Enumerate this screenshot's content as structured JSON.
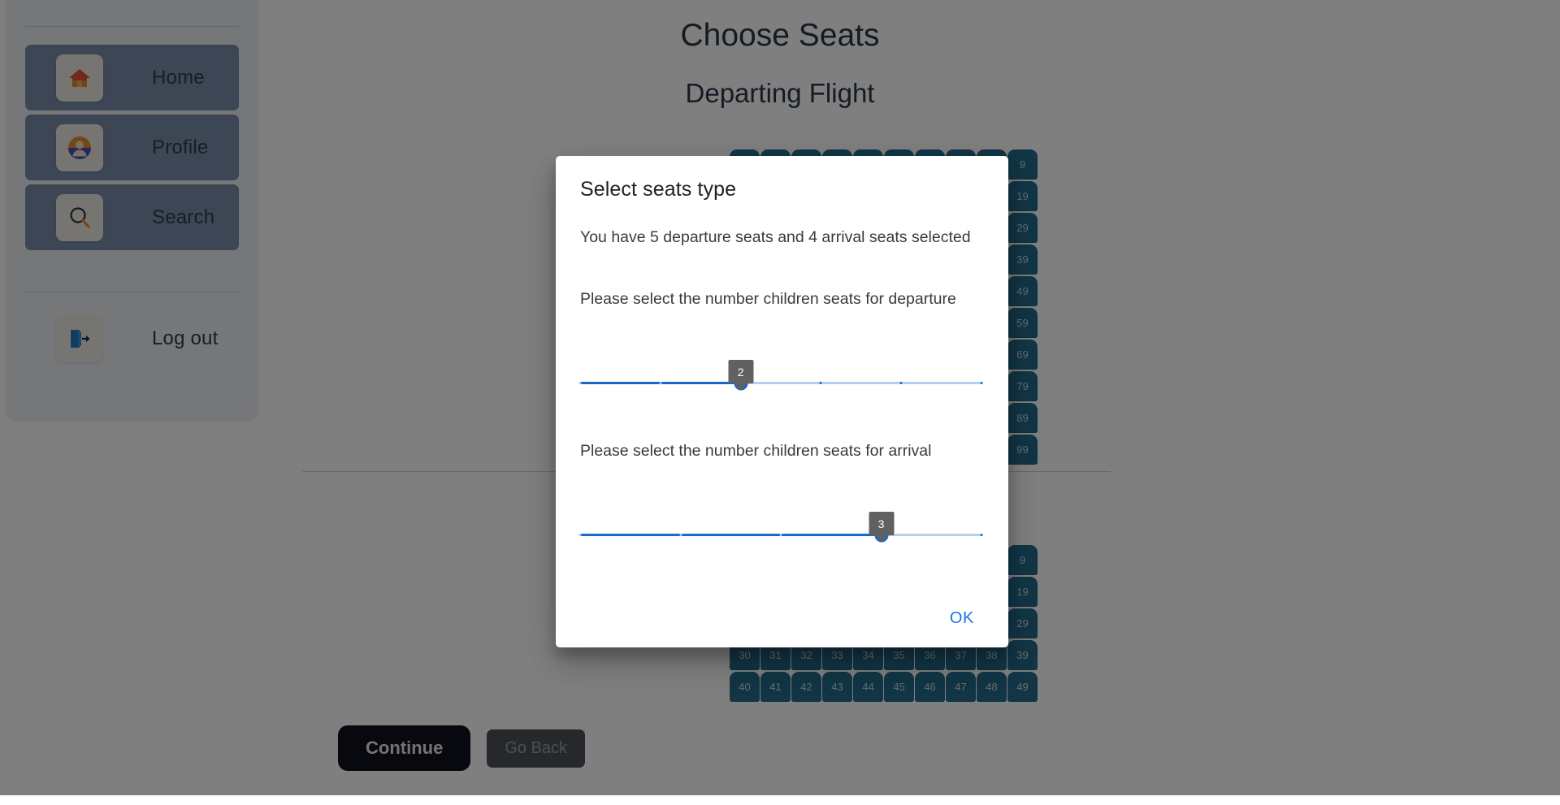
{
  "sidebar": {
    "items": [
      {
        "label": "Home",
        "icon": "home-icon"
      },
      {
        "label": "Profile",
        "icon": "profile-icon"
      },
      {
        "label": "Search",
        "icon": "search-icon"
      }
    ],
    "logout": {
      "label": "Log out",
      "icon": "logout-icon"
    }
  },
  "main": {
    "title": "Choose Seats",
    "subtitle": "Departing Flight",
    "continue_label": "Continue",
    "go_back_label": "Go Back"
  },
  "seats": {
    "departing_right_column": [
      "9",
      "19",
      "29",
      "39",
      "49",
      "59",
      "69",
      "79",
      "89",
      "99"
    ],
    "arriving_right_column": [
      "9",
      "19",
      "29",
      "39"
    ],
    "arriving_rows": [
      [
        "30",
        "31",
        "32",
        "33",
        "34",
        "35",
        "36",
        "37",
        "38",
        "39"
      ],
      [
        "40",
        "41",
        "42",
        "43",
        "44",
        "45",
        "46",
        "47",
        "48",
        "49"
      ]
    ],
    "seat_color": "#256c8c",
    "seat_text_color": "#cfd9de"
  },
  "dialog": {
    "title": "Select seats type",
    "summary": "You have 5 departure seats and 4 arrival seats selected",
    "departure_prompt": "Please select the number children seats for departure",
    "arrival_prompt": "Please select the number children seats for arrival",
    "ok_label": "OK",
    "accent_color": "#1769cc",
    "sliders": [
      {
        "name": "departure-children-seats",
        "value": "2",
        "min": 0,
        "max": 5,
        "ticks": [
          0,
          1,
          2,
          3,
          4,
          5
        ],
        "fill_percent": 40
      },
      {
        "name": "arrival-children-seats",
        "value": "3",
        "min": 0,
        "max": 4,
        "ticks": [
          0,
          1,
          2,
          3,
          4
        ],
        "fill_percent": 75
      }
    ]
  }
}
